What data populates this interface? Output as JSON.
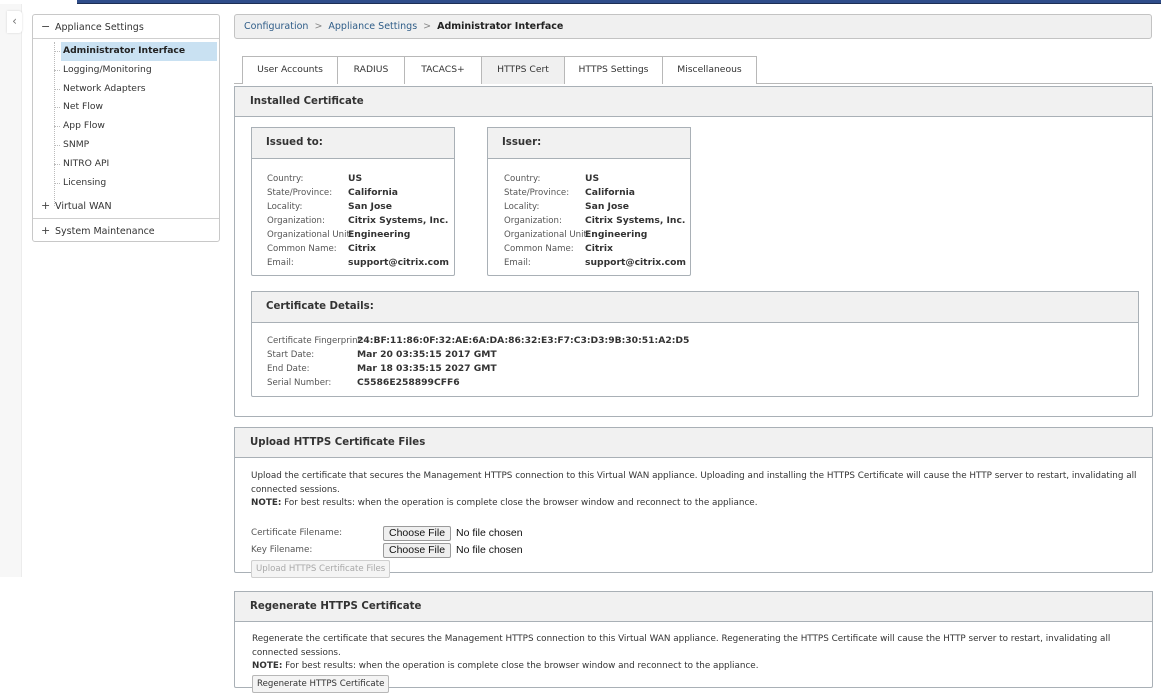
{
  "sidebar": {
    "collapse_icon": "chevron-left",
    "groups": [
      {
        "label": "Appliance Settings",
        "sign": "−",
        "expanded": true,
        "items": [
          {
            "label": "Administrator Interface",
            "active": true
          },
          {
            "label": "Logging/Monitoring"
          },
          {
            "label": "Network Adapters"
          },
          {
            "label": "Net Flow"
          },
          {
            "label": "App Flow"
          },
          {
            "label": "SNMP"
          },
          {
            "label": "NITRO API"
          },
          {
            "label": "Licensing"
          }
        ]
      },
      {
        "label": "Virtual WAN",
        "sign": "+",
        "expanded": false
      },
      {
        "label": "System Maintenance",
        "sign": "+",
        "expanded": false
      }
    ]
  },
  "breadcrumb": {
    "items": [
      "Configuration",
      "Appliance Settings"
    ],
    "separator": ">",
    "current": "Administrator Interface"
  },
  "tabs": [
    {
      "label": "User Accounts"
    },
    {
      "label": "RADIUS"
    },
    {
      "label": "TACACS+"
    },
    {
      "label": "HTTPS Cert",
      "active": true
    },
    {
      "label": "HTTPS Settings"
    },
    {
      "label": "Miscellaneous"
    }
  ],
  "installed_certificate": {
    "title": "Installed Certificate",
    "issued_to": {
      "title": "Issued to:",
      "fields": [
        {
          "label": "Country:",
          "value": "US"
        },
        {
          "label": "State/Province:",
          "value": "California"
        },
        {
          "label": "Locality:",
          "value": "San Jose"
        },
        {
          "label": "Organization:",
          "value": "Citrix Systems, Inc."
        },
        {
          "label": "Organizational Unit:",
          "value": "Engineering"
        },
        {
          "label": "Common Name:",
          "value": "Citrix"
        },
        {
          "label": "Email:",
          "value": "support@citrix.com"
        }
      ]
    },
    "issuer": {
      "title": "Issuer:",
      "fields": [
        {
          "label": "Country:",
          "value": "US"
        },
        {
          "label": "State/Province:",
          "value": "California"
        },
        {
          "label": "Locality:",
          "value": "San Jose"
        },
        {
          "label": "Organization:",
          "value": "Citrix Systems, Inc."
        },
        {
          "label": "Organizational Unit:",
          "value": "Engineering"
        },
        {
          "label": "Common Name:",
          "value": "Citrix"
        },
        {
          "label": "Email:",
          "value": "support@citrix.com"
        }
      ]
    },
    "details": {
      "title": "Certificate Details:",
      "fields": [
        {
          "label": "Certificate Fingerprint:",
          "value": "24:BF:11:86:0F:32:AE:6A:DA:86:32:E3:F7:C3:D3:9B:30:51:A2:D5"
        },
        {
          "label": "Start Date:",
          "value": "Mar 20 03:35:15 2017 GMT"
        },
        {
          "label": "End Date:",
          "value": "Mar 18 03:35:15 2027 GMT"
        },
        {
          "label": "Serial Number:",
          "value": "C5586E258899CFF6"
        }
      ]
    }
  },
  "upload": {
    "title": "Upload HTTPS Certificate Files",
    "description": "Upload the certificate that secures the Management HTTPS connection to this Virtual WAN appliance. Uploading and installing the HTTPS Certificate will cause the HTTP server to restart, invalidating all connected sessions.",
    "note_label": "NOTE:",
    "note_text": " For best results: when the operation is complete close the browser window and reconnect to the appliance.",
    "cert_label": "Certificate Filename:",
    "key_label": "Key Filename:",
    "choose_file_label": "Choose File",
    "no_file_label": "No file chosen",
    "submit_label": "Upload HTTPS Certificate Files",
    "submit_disabled": true
  },
  "regenerate": {
    "title": "Regenerate HTTPS Certificate",
    "description": "Regenerate the certificate that secures the Management HTTPS connection to this Virtual WAN appliance. Regenerating the HTTPS Certificate will cause the HTTP server to restart, invalidating all connected sessions.",
    "note_label": "NOTE:",
    "note_text": " For best results: when the operation is complete close the browser window and reconnect to the appliance.",
    "button_label": "Regenerate HTTPS Certificate"
  },
  "colors": {
    "topbar": "#2f4d8a",
    "active_nav": "#c9e1f2",
    "link": "#2f5d88",
    "panel_head": "#f1f1f1",
    "border": "#a9b0b6"
  }
}
